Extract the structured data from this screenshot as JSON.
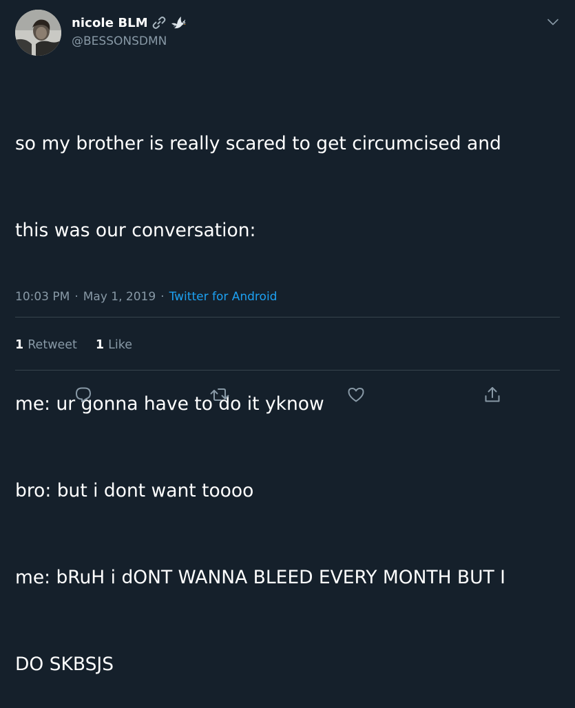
{
  "user": {
    "display_name": "nicole BLM",
    "handle": "@BESSONSDMN",
    "name_emojis": [
      "link-icon",
      "dove-icon"
    ]
  },
  "tweet": {
    "lines": [
      "so my brother is really scared to get circumcised and",
      "this was our conversation:",
      "",
      "me: ur gonna have to do it yknow",
      "bro: but i dont want toooo",
      "me: bRuH i dONT WANNA BLEED EVERY MONTH BUT I",
      "DO SKBSJS"
    ]
  },
  "meta": {
    "time": "10:03 PM",
    "dot": "·",
    "date": "May 1, 2019",
    "dot2": "·",
    "source": "Twitter for Android"
  },
  "stats": {
    "retweets_count": "1",
    "retweets_label": "Retweet",
    "likes_count": "1",
    "likes_label": "Like"
  },
  "actions": [
    "reply-icon",
    "retweet-icon",
    "like-icon",
    "share-icon"
  ],
  "colors": {
    "background": "#15202b",
    "text": "#ffffff",
    "secondary": "#8899a6",
    "accent": "#1da1f2",
    "divider": "#38444d"
  }
}
